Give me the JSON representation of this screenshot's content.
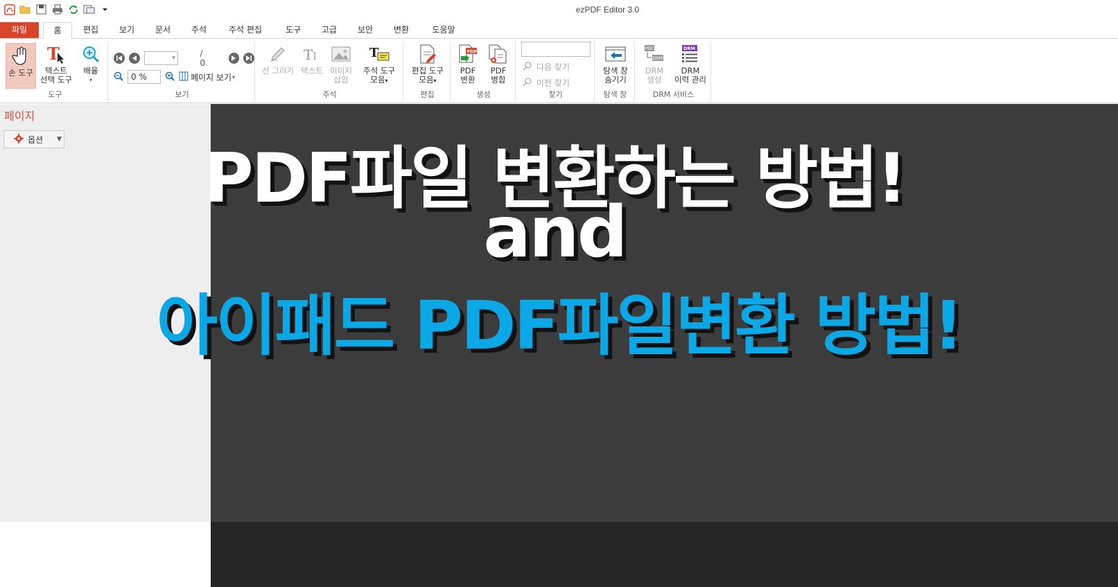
{
  "window": {
    "title": "ezPDF Editor 3.0"
  },
  "tabs": [
    {
      "label": "파일"
    },
    {
      "label": "홈"
    },
    {
      "label": "편집"
    },
    {
      "label": "보기"
    },
    {
      "label": "문서"
    },
    {
      "label": "주석"
    },
    {
      "label": "주석 편집"
    },
    {
      "label": "도구"
    },
    {
      "label": "고급"
    },
    {
      "label": "보안"
    },
    {
      "label": "변환"
    },
    {
      "label": "도움말"
    }
  ],
  "ribbon": {
    "tools": {
      "label": "도구",
      "hand": "손 도구",
      "text_select_1": "텍스트",
      "text_select_2": "선택 도구",
      "zoom": "배율"
    },
    "view": {
      "label": "보기",
      "page_total": "/ 0",
      "zoom_value": "0 %",
      "page_view": "페이지 보기"
    },
    "annot": {
      "label": "주석",
      "draw_line": "선 그리기",
      "text": "텍스트",
      "image_1": "이미지",
      "image_2": "삽입",
      "tools_1": "주석 도구",
      "tools_2": "모음"
    },
    "edit": {
      "label": "편집",
      "tools_1": "편집 도구",
      "tools_2": "모음"
    },
    "create": {
      "label": "생성",
      "convert_1": "PDF",
      "convert_2": "변환",
      "merge_1": "PDF",
      "merge_2": "병합"
    },
    "find": {
      "label": "찾기",
      "next": "다음 찾기",
      "prev": "이전 찾기"
    },
    "explorer": {
      "label": "탐색 창",
      "hide_1": "탐색 창",
      "hide_2": "숨기기"
    },
    "drm": {
      "label": "DRM 서비스",
      "create_1": "DRM",
      "create_2": "생성",
      "history_1": "DRM",
      "history_2": "이력 관리"
    }
  },
  "left_panel": {
    "title": "페이지",
    "options": "옵션"
  },
  "overlay": {
    "line1": "PDF파일 변환하는 방법!",
    "line2": "and",
    "line3": "아이패드 PDF파일변환 방법!"
  },
  "colors": {
    "accent": "#d9452b",
    "doc_bg": "#3c3c3c",
    "overlay_blue": "#0aa8e6"
  }
}
